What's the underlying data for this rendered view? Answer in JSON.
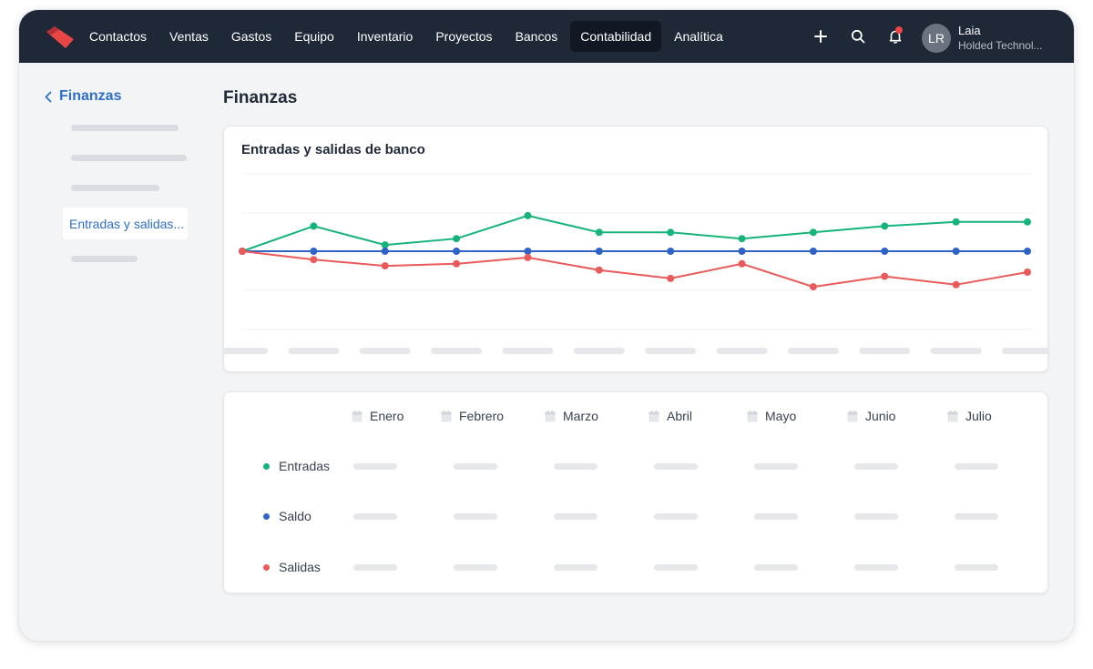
{
  "topbar": {
    "nav": [
      {
        "label": "Contactos",
        "active": false
      },
      {
        "label": "Ventas",
        "active": false
      },
      {
        "label": "Gastos",
        "active": false
      },
      {
        "label": "Equipo",
        "active": false
      },
      {
        "label": "Inventario",
        "active": false
      },
      {
        "label": "Proyectos",
        "active": false
      },
      {
        "label": "Bancos",
        "active": false
      },
      {
        "label": "Contabilidad",
        "active": true
      },
      {
        "label": "Analítica",
        "active": false
      }
    ],
    "actions": [
      "plus-icon",
      "search-icon",
      "bell-icon"
    ],
    "user": {
      "initials": "LR",
      "name": "Laia",
      "org": "Holded Technol..."
    }
  },
  "sidebar": {
    "back_label": "Finanzas",
    "active_item": "Entradas y salidas..."
  },
  "main": {
    "title": "Finanzas",
    "chart_title": "Entradas y salidas de banco"
  },
  "chart_data": {
    "type": "line",
    "title": "Entradas y salidas de banco",
    "xlabel": "",
    "ylabel": "",
    "x_tick_labels": "hidden (placeholder bars)",
    "points_per_series": 12,
    "grid": true,
    "series": [
      {
        "name": "Entradas",
        "color": "#16b47a",
        "values": [
          0,
          12,
          3,
          6,
          17,
          9,
          9,
          6,
          9,
          12,
          14,
          14
        ]
      },
      {
        "name": "Saldo",
        "color": "#2f63c6",
        "values": [
          0,
          0,
          0,
          0,
          0,
          0,
          0,
          0,
          0,
          0,
          0,
          0
        ]
      },
      {
        "name": "Salidas",
        "color": "#ea5a5a",
        "values": [
          0,
          -4,
          -7,
          -6,
          -3,
          -9,
          -13,
          -6,
          -17,
          -12,
          -16,
          -10
        ]
      }
    ]
  },
  "table": {
    "months": [
      "Enero",
      "Febrero",
      "Marzo",
      "Abril",
      "Mayo",
      "Junio",
      "Julio"
    ],
    "rows": [
      {
        "label": "Entradas",
        "color": "#16b47a"
      },
      {
        "label": "Saldo",
        "color": "#2f63c6"
      },
      {
        "label": "Salidas",
        "color": "#ea5a5a"
      }
    ]
  }
}
